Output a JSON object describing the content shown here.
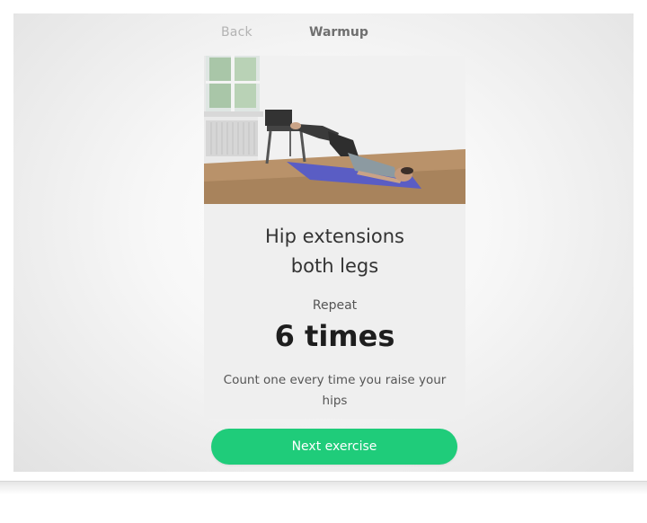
{
  "header": {
    "back_label": "Back",
    "title": "Warmup"
  },
  "exercise": {
    "name_line1": "Hip extensions",
    "name_line2": "both legs",
    "repeat_label": "Repeat",
    "repeat_count": "6 times",
    "instruction": "Count one every time you raise your hips"
  },
  "actions": {
    "next_label": "Next exercise"
  },
  "colors": {
    "accent": "#1fcc7a",
    "card_background": "#efefef"
  }
}
